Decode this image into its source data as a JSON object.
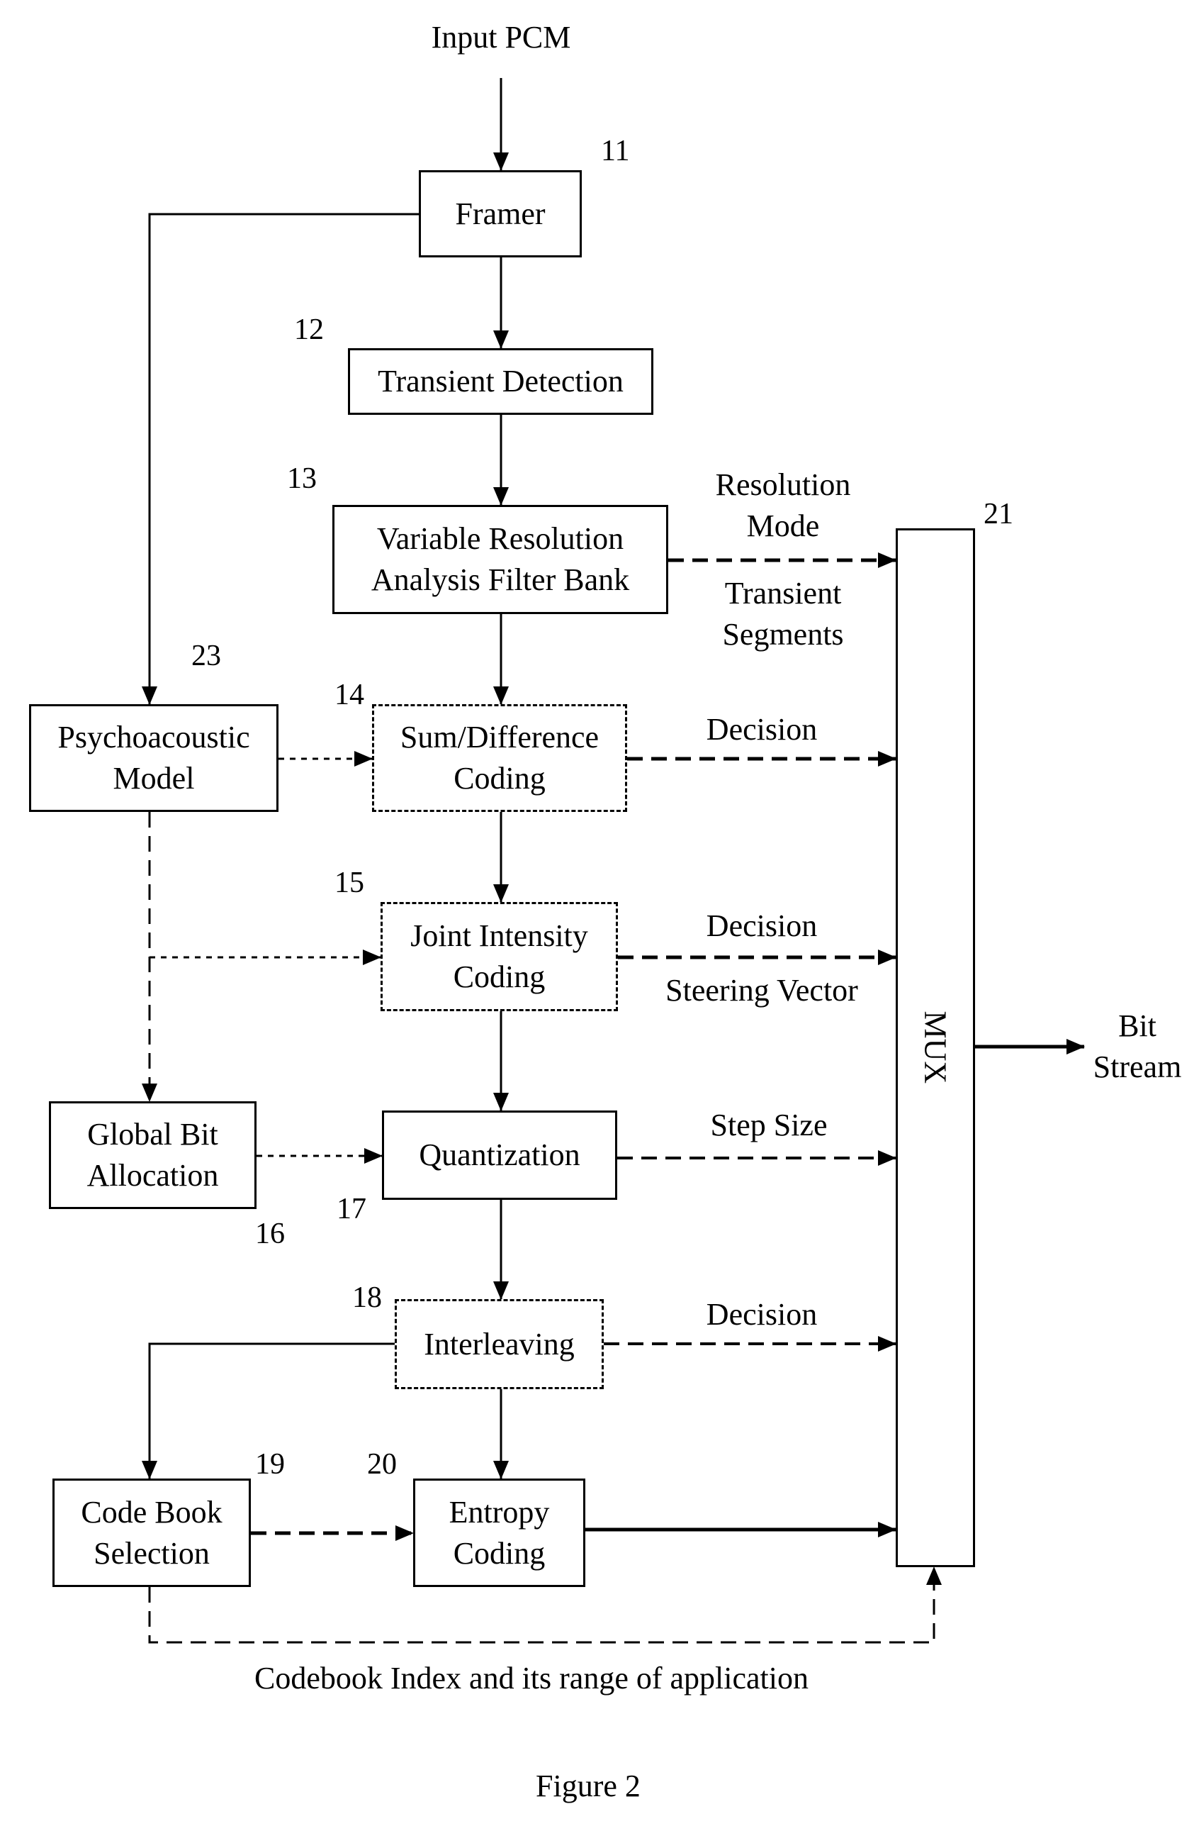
{
  "figure": {
    "caption": "Figure 2",
    "input_label": "Input PCM",
    "output_label_line1": "Bit",
    "output_label_line2": "Stream",
    "bottom_label": "Codebook Index and its range of application"
  },
  "blocks": {
    "framer": {
      "number": "11",
      "line1": "Framer",
      "line2": ""
    },
    "transient_detection": {
      "number": "12",
      "line1": "Transient Detection",
      "line2": ""
    },
    "filter_bank": {
      "number": "13",
      "line1": "Variable Resolution",
      "line2": "Analysis Filter Bank"
    },
    "sum_difference": {
      "number": "14",
      "line1": "Sum/Difference",
      "line2": "Coding"
    },
    "joint_intensity": {
      "number": "15",
      "line1": "Joint Intensity",
      "line2": "Coding"
    },
    "global_bit_allocation": {
      "number": "16",
      "line1": "Global Bit",
      "line2": "Allocation"
    },
    "quantization": {
      "number": "17",
      "line1": "Quantization",
      "line2": ""
    },
    "interleaving": {
      "number": "18",
      "line1": "Interleaving",
      "line2": ""
    },
    "codebook_selection": {
      "number": "19",
      "line1": "Code Book",
      "line2": "Selection"
    },
    "entropy_coding": {
      "number": "20",
      "line1": "Entropy",
      "line2": "Coding"
    },
    "mux": {
      "number": "21",
      "label": "MUX"
    },
    "psychoacoustic": {
      "number": "23",
      "line1": "Psychoacoustic",
      "line2": "Model"
    }
  },
  "signals": {
    "resolution_mode_1": "Resolution",
    "resolution_mode_2": "Mode",
    "transient_segments_1": "Transient",
    "transient_segments_2": "Segments",
    "sumdiff_decision": "Decision",
    "joint_decision": "Decision",
    "steering_vector": "Steering Vector",
    "step_size": "Step Size",
    "interleave_decision": "Decision"
  }
}
